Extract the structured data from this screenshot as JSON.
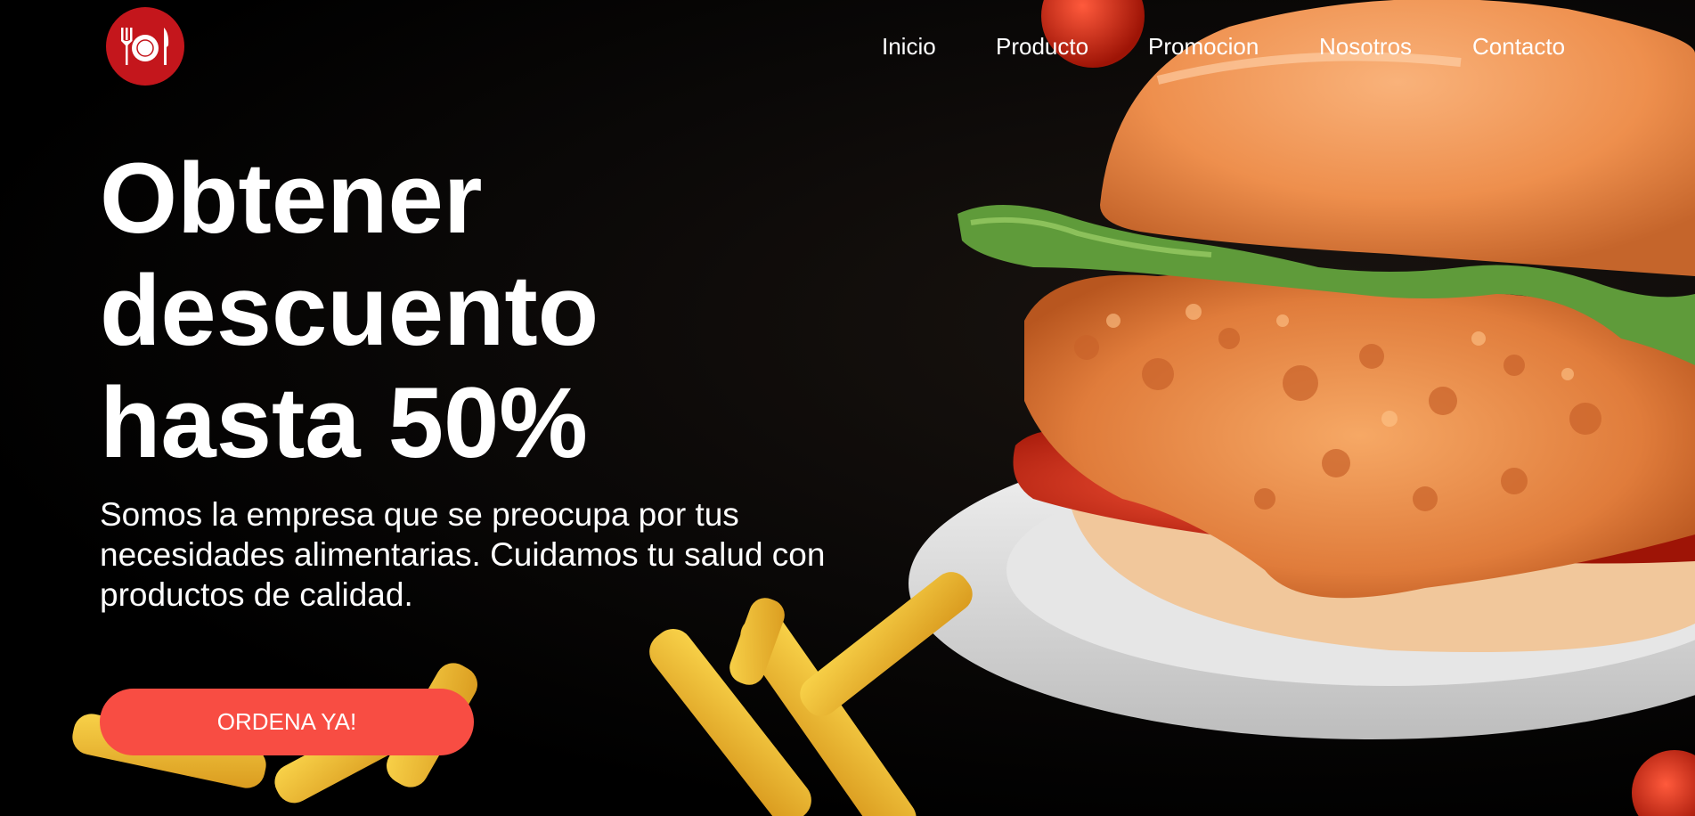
{
  "nav": {
    "logo_icon": "plate-cutlery-icon",
    "items": [
      {
        "label": "Inicio"
      },
      {
        "label": "Producto"
      },
      {
        "label": "Promocion"
      },
      {
        "label": "Nosotros"
      },
      {
        "label": "Contacto"
      }
    ]
  },
  "hero": {
    "headline": "Obtener descuento hasta 50%",
    "subtitle": "Somos la empresa que se preocupa por tus necesidades alimentarias. Cuidamos tu salud con productos de calidad.",
    "cta_label": "ORDENA YA!",
    "image": "fried-chicken-burger-with-fries"
  },
  "colors": {
    "background": "#000000",
    "accent": "#f84d43",
    "logo": "#c4161c",
    "text": "#ffffff"
  }
}
